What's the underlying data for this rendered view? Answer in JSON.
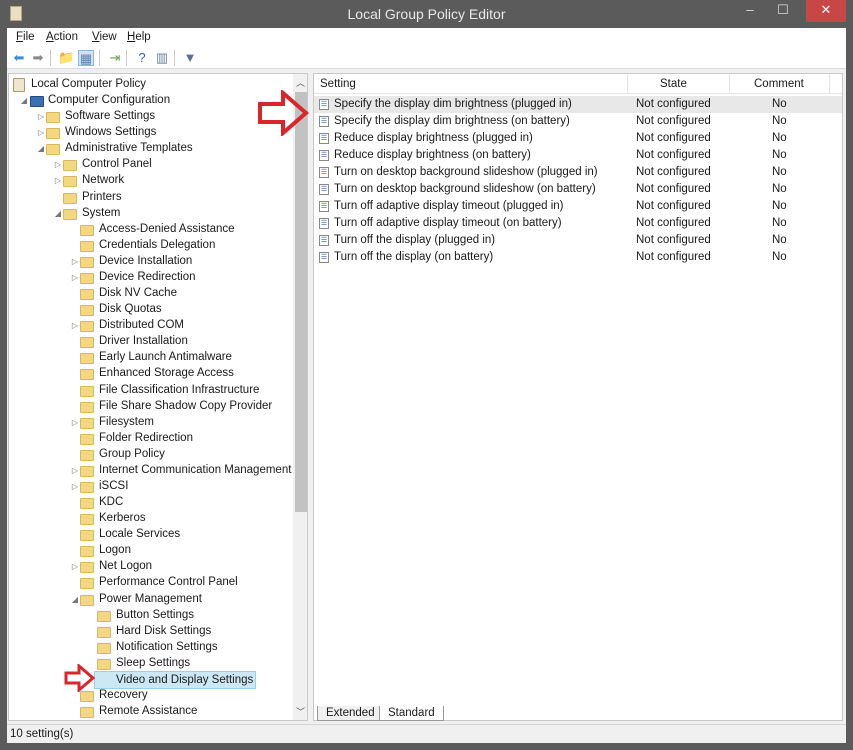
{
  "window": {
    "title": "Local Group Policy Editor",
    "minimize": "–",
    "maximize": "☐",
    "close": "✕"
  },
  "menu": [
    {
      "label": "File",
      "key": "F",
      "rest": "ile"
    },
    {
      "label": "Action",
      "key": "A",
      "rest": "ction"
    },
    {
      "label": "View",
      "key": "V",
      "rest": "iew"
    },
    {
      "label": "Help",
      "key": "H",
      "rest": "elp"
    }
  ],
  "toolbar": [
    {
      "icon": "back-icon",
      "glyph": "⬅"
    },
    {
      "icon": "forward-icon",
      "glyph": "➡"
    },
    {
      "icon": "up-folder-icon",
      "glyph": "📁"
    },
    {
      "icon": "show-hide-tree-icon",
      "glyph": "▦"
    },
    {
      "icon": "export-list-icon",
      "glyph": "⇥"
    },
    {
      "icon": "help-icon",
      "glyph": "?"
    },
    {
      "icon": "show-hide-action-pane-icon",
      "glyph": "▥"
    },
    {
      "icon": "filter-icon",
      "glyph": "▼"
    }
  ],
  "tree": [
    {
      "label": "Local Computer Policy",
      "level": 0,
      "exp": "",
      "icon": "policy"
    },
    {
      "label": "Computer Configuration",
      "level": 1,
      "exp": "open",
      "icon": "computer"
    },
    {
      "label": "Software Settings",
      "level": 2,
      "exp": "closed"
    },
    {
      "label": "Windows Settings",
      "level": 2,
      "exp": "closed"
    },
    {
      "label": "Administrative Templates",
      "level": 2,
      "exp": "open"
    },
    {
      "label": "Control Panel",
      "level": 3,
      "exp": "closed"
    },
    {
      "label": "Network",
      "level": 3,
      "exp": "closed"
    },
    {
      "label": "Printers",
      "level": 3,
      "exp": ""
    },
    {
      "label": "System",
      "level": 3,
      "exp": "open"
    },
    {
      "label": "Access-Denied Assistance",
      "level": 4,
      "exp": ""
    },
    {
      "label": "Credentials Delegation",
      "level": 4,
      "exp": ""
    },
    {
      "label": "Device Installation",
      "level": 4,
      "exp": "closed"
    },
    {
      "label": "Device Redirection",
      "level": 4,
      "exp": "closed"
    },
    {
      "label": "Disk NV Cache",
      "level": 4,
      "exp": ""
    },
    {
      "label": "Disk Quotas",
      "level": 4,
      "exp": ""
    },
    {
      "label": "Distributed COM",
      "level": 4,
      "exp": "closed"
    },
    {
      "label": "Driver Installation",
      "level": 4,
      "exp": ""
    },
    {
      "label": "Early Launch Antimalware",
      "level": 4,
      "exp": ""
    },
    {
      "label": "Enhanced Storage Access",
      "level": 4,
      "exp": ""
    },
    {
      "label": "File Classification Infrastructure",
      "level": 4,
      "exp": ""
    },
    {
      "label": "File Share Shadow Copy Provider",
      "level": 4,
      "exp": ""
    },
    {
      "label": "Filesystem",
      "level": 4,
      "exp": "closed"
    },
    {
      "label": "Folder Redirection",
      "level": 4,
      "exp": ""
    },
    {
      "label": "Group Policy",
      "level": 4,
      "exp": ""
    },
    {
      "label": "Internet Communication Management",
      "level": 4,
      "exp": "closed"
    },
    {
      "label": "iSCSI",
      "level": 4,
      "exp": "closed"
    },
    {
      "label": "KDC",
      "level": 4,
      "exp": ""
    },
    {
      "label": "Kerberos",
      "level": 4,
      "exp": ""
    },
    {
      "label": "Locale Services",
      "level": 4,
      "exp": ""
    },
    {
      "label": "Logon",
      "level": 4,
      "exp": ""
    },
    {
      "label": "Net Logon",
      "level": 4,
      "exp": "closed"
    },
    {
      "label": "Performance Control Panel",
      "level": 4,
      "exp": ""
    },
    {
      "label": "Power Management",
      "level": 4,
      "exp": "open"
    },
    {
      "label": "Button Settings",
      "level": 5,
      "exp": ""
    },
    {
      "label": "Hard Disk Settings",
      "level": 5,
      "exp": ""
    },
    {
      "label": "Notification Settings",
      "level": 5,
      "exp": ""
    },
    {
      "label": "Sleep Settings",
      "level": 5,
      "exp": ""
    },
    {
      "label": "Video and Display Settings",
      "level": 5,
      "exp": "",
      "selected": true
    },
    {
      "label": "Recovery",
      "level": 4,
      "exp": ""
    },
    {
      "label": "Remote Assistance",
      "level": 4,
      "exp": ""
    }
  ],
  "table": {
    "columns": [
      "Setting",
      "State",
      "Comment"
    ],
    "rows": [
      [
        "Specify the display dim brightness (plugged in)",
        "Not configured",
        "No"
      ],
      [
        "Specify the display dim brightness (on battery)",
        "Not configured",
        "No"
      ],
      [
        "Reduce display brightness (plugged in)",
        "Not configured",
        "No"
      ],
      [
        "Reduce display brightness (on battery)",
        "Not configured",
        "No"
      ],
      [
        "Turn on desktop background slideshow (plugged in)",
        "Not configured",
        "No"
      ],
      [
        "Turn on desktop background slideshow (on battery)",
        "Not configured",
        "No"
      ],
      [
        "Turn off adaptive display timeout (plugged in)",
        "Not configured",
        "No"
      ],
      [
        "Turn off adaptive display timeout (on battery)",
        "Not configured",
        "No"
      ],
      [
        "Turn off the display (plugged in)",
        "Not configured",
        "No"
      ],
      [
        "Turn off the display (on battery)",
        "Not configured",
        "No"
      ]
    ]
  },
  "tabs": [
    {
      "label": "Extended",
      "active": false
    },
    {
      "label": "Standard",
      "active": true
    }
  ],
  "status": "10 setting(s)",
  "colors": {
    "annotation_arrow": "#d9262b",
    "selection": "#cce8f4",
    "close_button": "#c74646"
  }
}
